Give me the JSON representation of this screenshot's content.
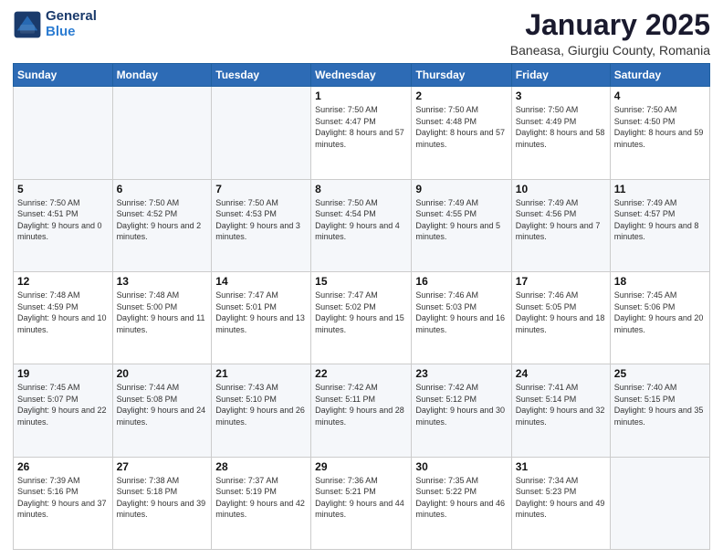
{
  "header": {
    "logo_line1": "General",
    "logo_line2": "Blue",
    "month": "January 2025",
    "location": "Baneasa, Giurgiu County, Romania"
  },
  "weekdays": [
    "Sunday",
    "Monday",
    "Tuesday",
    "Wednesday",
    "Thursday",
    "Friday",
    "Saturday"
  ],
  "weeks": [
    [
      {
        "day": "",
        "info": ""
      },
      {
        "day": "",
        "info": ""
      },
      {
        "day": "",
        "info": ""
      },
      {
        "day": "1",
        "info": "Sunrise: 7:50 AM\nSunset: 4:47 PM\nDaylight: 8 hours and 57 minutes."
      },
      {
        "day": "2",
        "info": "Sunrise: 7:50 AM\nSunset: 4:48 PM\nDaylight: 8 hours and 57 minutes."
      },
      {
        "day": "3",
        "info": "Sunrise: 7:50 AM\nSunset: 4:49 PM\nDaylight: 8 hours and 58 minutes."
      },
      {
        "day": "4",
        "info": "Sunrise: 7:50 AM\nSunset: 4:50 PM\nDaylight: 8 hours and 59 minutes."
      }
    ],
    [
      {
        "day": "5",
        "info": "Sunrise: 7:50 AM\nSunset: 4:51 PM\nDaylight: 9 hours and 0 minutes."
      },
      {
        "day": "6",
        "info": "Sunrise: 7:50 AM\nSunset: 4:52 PM\nDaylight: 9 hours and 2 minutes."
      },
      {
        "day": "7",
        "info": "Sunrise: 7:50 AM\nSunset: 4:53 PM\nDaylight: 9 hours and 3 minutes."
      },
      {
        "day": "8",
        "info": "Sunrise: 7:50 AM\nSunset: 4:54 PM\nDaylight: 9 hours and 4 minutes."
      },
      {
        "day": "9",
        "info": "Sunrise: 7:49 AM\nSunset: 4:55 PM\nDaylight: 9 hours and 5 minutes."
      },
      {
        "day": "10",
        "info": "Sunrise: 7:49 AM\nSunset: 4:56 PM\nDaylight: 9 hours and 7 minutes."
      },
      {
        "day": "11",
        "info": "Sunrise: 7:49 AM\nSunset: 4:57 PM\nDaylight: 9 hours and 8 minutes."
      }
    ],
    [
      {
        "day": "12",
        "info": "Sunrise: 7:48 AM\nSunset: 4:59 PM\nDaylight: 9 hours and 10 minutes."
      },
      {
        "day": "13",
        "info": "Sunrise: 7:48 AM\nSunset: 5:00 PM\nDaylight: 9 hours and 11 minutes."
      },
      {
        "day": "14",
        "info": "Sunrise: 7:47 AM\nSunset: 5:01 PM\nDaylight: 9 hours and 13 minutes."
      },
      {
        "day": "15",
        "info": "Sunrise: 7:47 AM\nSunset: 5:02 PM\nDaylight: 9 hours and 15 minutes."
      },
      {
        "day": "16",
        "info": "Sunrise: 7:46 AM\nSunset: 5:03 PM\nDaylight: 9 hours and 16 minutes."
      },
      {
        "day": "17",
        "info": "Sunrise: 7:46 AM\nSunset: 5:05 PM\nDaylight: 9 hours and 18 minutes."
      },
      {
        "day": "18",
        "info": "Sunrise: 7:45 AM\nSunset: 5:06 PM\nDaylight: 9 hours and 20 minutes."
      }
    ],
    [
      {
        "day": "19",
        "info": "Sunrise: 7:45 AM\nSunset: 5:07 PM\nDaylight: 9 hours and 22 minutes."
      },
      {
        "day": "20",
        "info": "Sunrise: 7:44 AM\nSunset: 5:08 PM\nDaylight: 9 hours and 24 minutes."
      },
      {
        "day": "21",
        "info": "Sunrise: 7:43 AM\nSunset: 5:10 PM\nDaylight: 9 hours and 26 minutes."
      },
      {
        "day": "22",
        "info": "Sunrise: 7:42 AM\nSunset: 5:11 PM\nDaylight: 9 hours and 28 minutes."
      },
      {
        "day": "23",
        "info": "Sunrise: 7:42 AM\nSunset: 5:12 PM\nDaylight: 9 hours and 30 minutes."
      },
      {
        "day": "24",
        "info": "Sunrise: 7:41 AM\nSunset: 5:14 PM\nDaylight: 9 hours and 32 minutes."
      },
      {
        "day": "25",
        "info": "Sunrise: 7:40 AM\nSunset: 5:15 PM\nDaylight: 9 hours and 35 minutes."
      }
    ],
    [
      {
        "day": "26",
        "info": "Sunrise: 7:39 AM\nSunset: 5:16 PM\nDaylight: 9 hours and 37 minutes."
      },
      {
        "day": "27",
        "info": "Sunrise: 7:38 AM\nSunset: 5:18 PM\nDaylight: 9 hours and 39 minutes."
      },
      {
        "day": "28",
        "info": "Sunrise: 7:37 AM\nSunset: 5:19 PM\nDaylight: 9 hours and 42 minutes."
      },
      {
        "day": "29",
        "info": "Sunrise: 7:36 AM\nSunset: 5:21 PM\nDaylight: 9 hours and 44 minutes."
      },
      {
        "day": "30",
        "info": "Sunrise: 7:35 AM\nSunset: 5:22 PM\nDaylight: 9 hours and 46 minutes."
      },
      {
        "day": "31",
        "info": "Sunrise: 7:34 AM\nSunset: 5:23 PM\nDaylight: 9 hours and 49 minutes."
      },
      {
        "day": "",
        "info": ""
      }
    ]
  ]
}
